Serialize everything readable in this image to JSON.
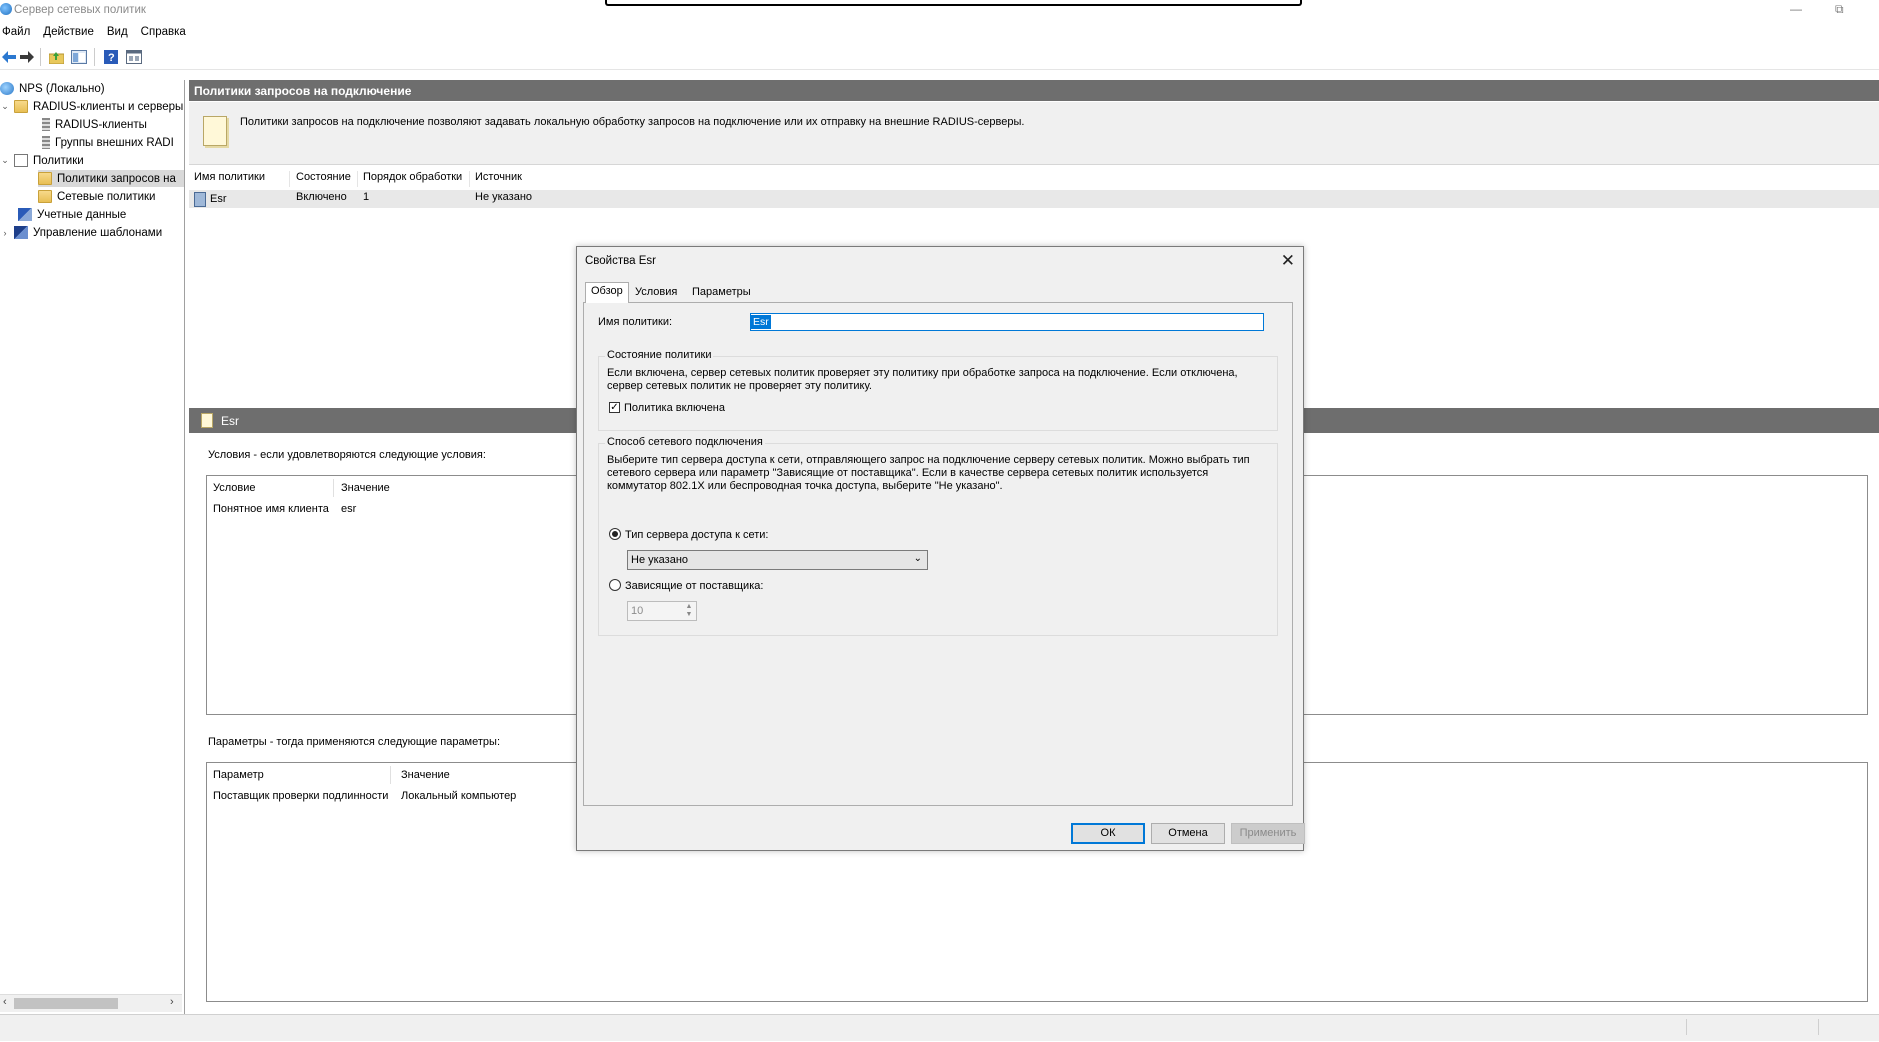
{
  "window": {
    "title": "Сервер сетевых политик",
    "restore_glyph": "⧉",
    "minimize_glyph": "—"
  },
  "menu": [
    "Файл",
    "Действие",
    "Вид",
    "Справка"
  ],
  "toolbar": {
    "icons": [
      "back-icon",
      "forward-icon",
      "up-folder-icon",
      "show-hide-tree-icon",
      "help-icon",
      "properties-icon"
    ]
  },
  "tree": [
    {
      "label": "NPS (Локально)"
    },
    {
      "label": "RADIUS-клиенты и серверы",
      "expander": "⌄"
    },
    {
      "label": "RADIUS-клиенты"
    },
    {
      "label": "Группы внешних RADI"
    },
    {
      "label": "Политики",
      "expander": "⌄"
    },
    {
      "label": "Политики запросов на"
    },
    {
      "label": "Сетевые политики"
    },
    {
      "label": "Учетные данные"
    },
    {
      "label": "Управление шаблонами",
      "expander": "›"
    }
  ],
  "tree_scroll": {
    "left": "‹",
    "right": "›"
  },
  "top_panel": {
    "header": "Политики запросов на подключение",
    "description": "Политики запросов на подключение позволяют задавать локальную обработку запросов на подключение или их отправку на внешние RADIUS-серверы."
  },
  "policy_list": {
    "columns": [
      "Имя политики",
      "Состояние",
      "Порядок обработки",
      "Источник"
    ],
    "rows": [
      {
        "name": "Esr",
        "state": "Включено",
        "order": "1",
        "source": "Не указано"
      }
    ]
  },
  "details": {
    "header": "Esr",
    "conditions_label": "Условия - если удовлетворяются следующие условия:",
    "conditions": {
      "col_condition": "Условие",
      "col_value": "Значение",
      "condition": "Понятное имя клиента",
      "value": "esr"
    },
    "settings_label": "Параметры - тогда применяются следующие параметры:",
    "settings": {
      "col_param": "Параметр",
      "col_value": "Значение",
      "param": "Поставщик проверки подлинности",
      "value": "Локальный компьютер"
    }
  },
  "dialog": {
    "title": "Свойства Esr",
    "close_glyph": "✕",
    "tabs": [
      "Обзор",
      "Условия",
      "Параметры"
    ],
    "name_label": "Имя политики:",
    "name_value": "Esr",
    "state_group": {
      "legend": "Состояние политики",
      "text": "Если включена, сервер сетевых политик проверяет эту политику при обработке запроса на подключение. Если отключена, сервер сетевых политик не проверяет эту политику.",
      "checkbox_label": "Политика включена",
      "checked": true,
      "check_glyph": "✓"
    },
    "conn_group": {
      "legend": "Способ сетевого подключения",
      "text": "Выберите тип сервера доступа к сети, отправляющего запрос на подключение серверу сетевых политик. Можно выбрать тип сетевого сервера или параметр \"Зависящие от поставщика\". Если в качестве сервера сетевых политик используется коммутатор 802.1X или беспроводная точка доступа, выберите \"Не указано\".",
      "radio1_label": "Тип сервера доступа к сети:",
      "select_value": "Не указано",
      "select_arrow": "⌄",
      "radio2_label": "Зависящие от поставщика:",
      "spin_value": "10",
      "spin_up": "▲",
      "spin_down": "▼"
    },
    "buttons": {
      "ok": "ОК",
      "cancel": "Отмена",
      "apply": "Применить"
    }
  }
}
